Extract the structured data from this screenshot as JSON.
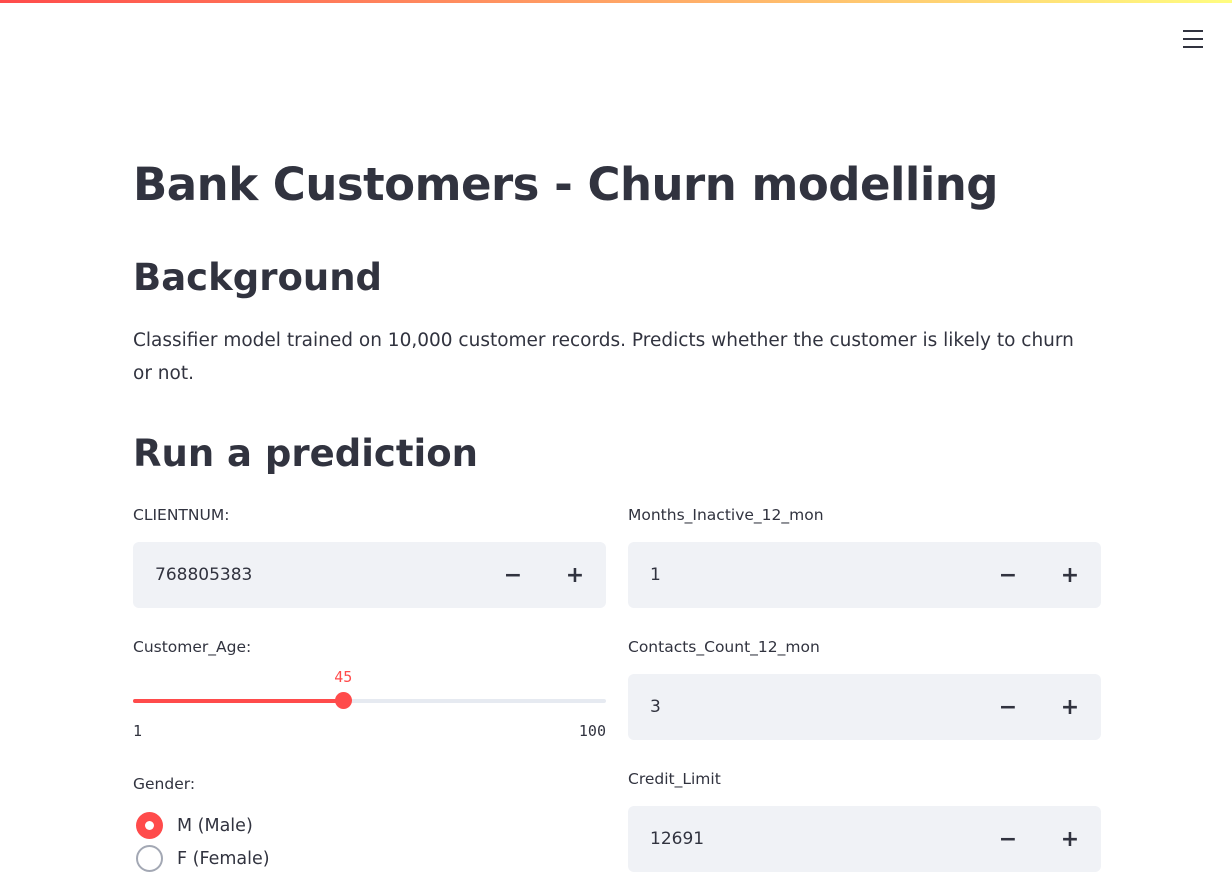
{
  "header": {
    "menu_icon": "hamburger-icon",
    "accent": "#ff4b4b"
  },
  "title": "Bank Customers - Churn modelling",
  "background": {
    "heading": "Background",
    "text": "Classifier model trained on 10,000 customer records. Predicts whether the customer is likely to churn or not."
  },
  "predict": {
    "heading": "Run a prediction",
    "clientnum": {
      "label": "CLIENTNUM:",
      "value": "768805383"
    },
    "age": {
      "label": "Customer_Age:",
      "value": 45,
      "value_label": "45",
      "min": 1,
      "max": 100,
      "min_label": "1",
      "max_label": "100"
    },
    "gender": {
      "label": "Gender:",
      "options": [
        "M (Male)",
        "F (Female)"
      ],
      "selected": "M (Male)"
    },
    "months_inactive": {
      "label": "Months_Inactive_12_mon",
      "value": "1"
    },
    "contacts": {
      "label": "Contacts_Count_12_mon",
      "value": "3"
    },
    "credit_limit": {
      "label": "Credit_Limit",
      "value": "12691"
    },
    "minus": "−",
    "plus": "+"
  }
}
